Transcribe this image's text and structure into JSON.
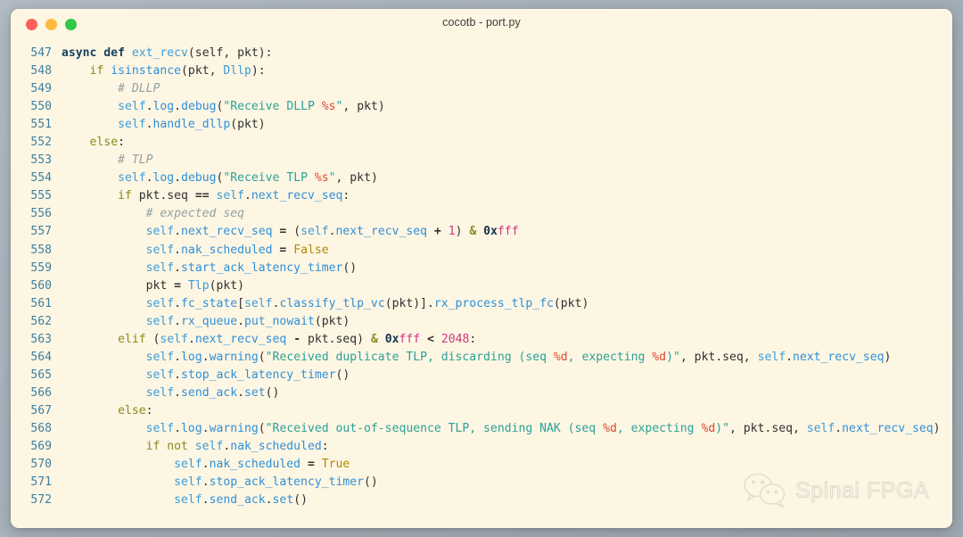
{
  "window": {
    "title": "cocotb - port.py",
    "traffic_lights": [
      {
        "name": "close",
        "color": "#fc6058"
      },
      {
        "name": "minimize",
        "color": "#fcbb40"
      },
      {
        "name": "maximize",
        "color": "#33c748"
      }
    ],
    "background": "#fdf6e3",
    "desktop_background": "#a8b2bb"
  },
  "watermark": {
    "text": "Spinal FPGA",
    "icon": "wechat-icon"
  },
  "editor": {
    "language": "python",
    "first_line_number": 547,
    "last_line_number": 572,
    "line_numbers": [
      547,
      548,
      549,
      550,
      551,
      552,
      553,
      554,
      555,
      556,
      557,
      558,
      559,
      560,
      561,
      562,
      563,
      564,
      565,
      566,
      567,
      568,
      569,
      570,
      571,
      572
    ],
    "lines": [
      "async def ext_recv(self, pkt):",
      "    if isinstance(pkt, Dllp):",
      "        # DLLP",
      "        self.log.debug(\"Receive DLLP %s\", pkt)",
      "        self.handle_dllp(pkt)",
      "    else:",
      "        # TLP",
      "        self.log.debug(\"Receive TLP %s\", pkt)",
      "        if pkt.seq == self.next_recv_seq:",
      "            # expected seq",
      "            self.next_recv_seq = (self.next_recv_seq + 1) & 0xfff",
      "            self.nak_scheduled = False",
      "            self.start_ack_latency_timer()",
      "            pkt = Tlp(pkt)",
      "            self.fc_state[self.classify_tlp_vc(pkt)].rx_process_tlp_fc(pkt)",
      "            self.rx_queue.put_nowait(pkt)",
      "        elif (self.next_recv_seq - pkt.seq) & 0xfff < 2048:",
      "            self.log.warning(\"Received duplicate TLP, discarding (seq %d, expecting %d)\", pkt.seq, self.next_recv_seq)",
      "            self.stop_ack_latency_timer()",
      "            self.send_ack.set()",
      "        else:",
      "            self.log.warning(\"Received out-of-sequence TLP, sending NAK (seq %d, expecting %d)\", pkt.seq, self.next_recv_seq)",
      "            if not self.nak_scheduled:",
      "                self.nak_scheduled = True",
      "                self.stop_ack_latency_timer()",
      "                self.send_ack.set()"
    ],
    "theme_colors": {
      "background": "#fdf6e3",
      "line_number": "#3f7f9f",
      "keyword": "#8a8a1e",
      "definition_keyword": "#18415c",
      "function": "#3d9bd6",
      "attribute": "#2f8fd8",
      "string": "#2aa198",
      "format_spec": "#dc4a32",
      "number": "#d33682",
      "comment": "#93a1a1",
      "boolean": "#b58900",
      "text": "#303030"
    }
  }
}
